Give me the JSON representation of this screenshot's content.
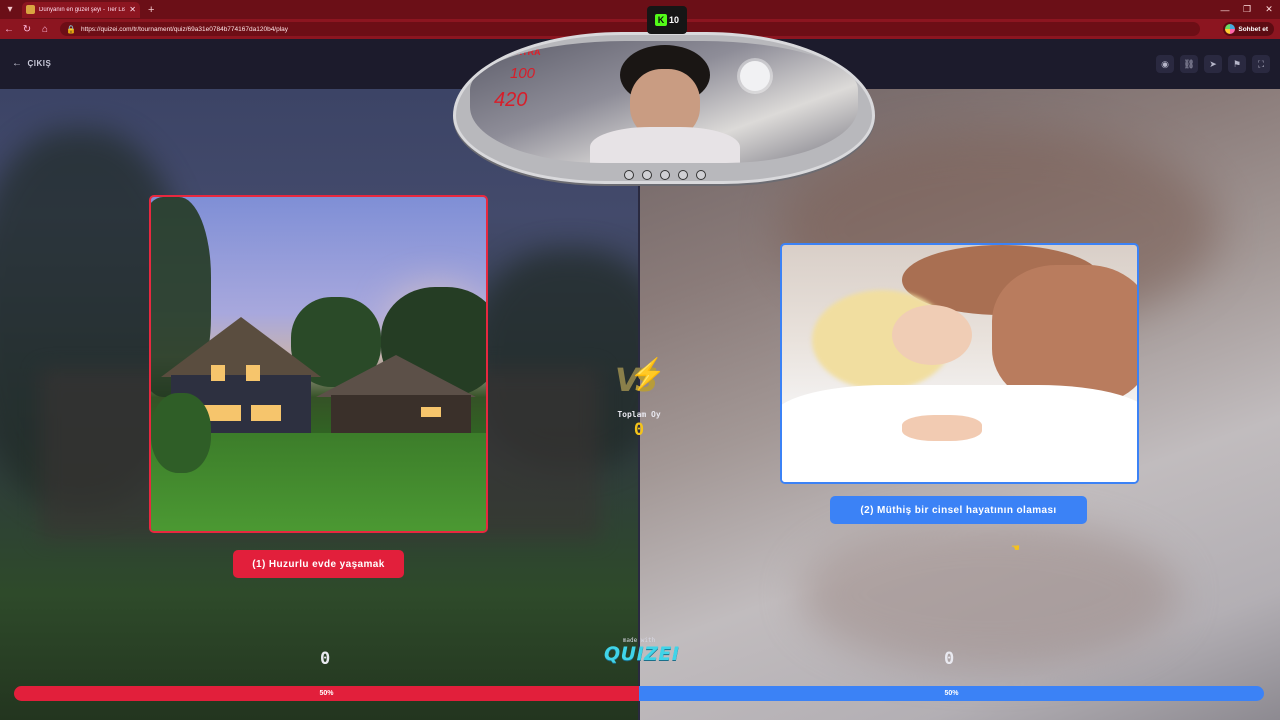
{
  "browser": {
    "tab_title": "Dünyanın en güzel şeyi - Tier List...",
    "url": "https://quizei.com/tr/tournament/quiz/69a31e0784b774167da120b4/play",
    "chat_label": "Sohbet et"
  },
  "topnav": {
    "exit_label": "ÇIKIŞ"
  },
  "left_option": {
    "label": "(1) Huzurlu evde yaşamak",
    "votes": "0",
    "percent_label": "50%",
    "percent": 50,
    "color": "#e21f3b"
  },
  "right_option": {
    "label": "(2) Müthiş bir cinsel hayatının olaması",
    "votes": "0",
    "percent_label": "50%",
    "percent": 50,
    "color": "#3b82f6"
  },
  "center": {
    "total_label": "Toplam Oy",
    "total_value": "0",
    "made_with": "made with",
    "brand": "QUIZEI"
  },
  "overlay": {
    "kick_count": "10",
    "stat_top": "EXTRA",
    "stat_mid": "100",
    "stat_big": "420"
  },
  "icons": [
    "menu-icon",
    "back-icon",
    "reload-icon",
    "home-icon",
    "lock-icon",
    "eye-icon",
    "link-icon",
    "send-icon",
    "flag-icon",
    "fullscreen-icon",
    "arrow-left-icon",
    "lightning-icon"
  ]
}
